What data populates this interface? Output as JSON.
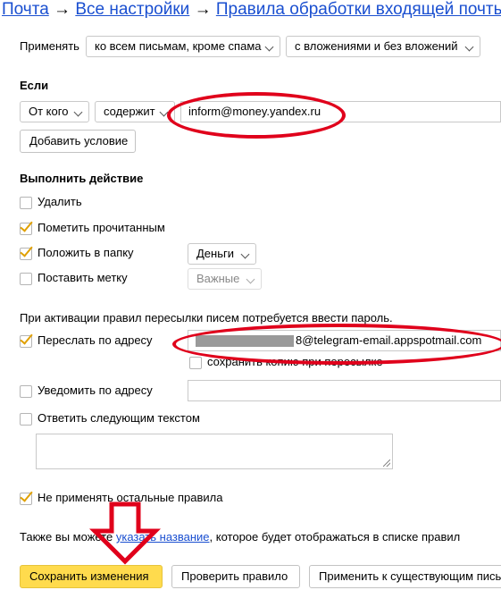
{
  "breadcrumb": {
    "mail": "Почта",
    "arrow": "→",
    "settings": "Все настройки",
    "rules": "Правила обработки входящей почты"
  },
  "apply": {
    "label": "Применять",
    "scope": "ко всем письмам, кроме спама",
    "attachments": "с вложениями и без вложений"
  },
  "condition": {
    "heading": "Если",
    "field": "От кого",
    "operator": "содержит",
    "value": "inform@money.yandex.ru",
    "add_button": "Добавить условие"
  },
  "actions": {
    "heading": "Выполнить действие",
    "delete": {
      "label": "Удалить",
      "checked": false
    },
    "mark_read": {
      "label": "Пометить прочитанным",
      "checked": true
    },
    "move_folder": {
      "label": "Положить в папку",
      "checked": true,
      "folder": "Деньги"
    },
    "set_label": {
      "label": "Поставить метку",
      "checked": false,
      "label_value": "Важные"
    }
  },
  "forwarding": {
    "notice": "При активации правил пересылки писем потребуется ввести пароль.",
    "forward": {
      "label": "Переслать по адресу",
      "checked": true,
      "address_suffix": "8@telegram-email.appspotmail.com"
    },
    "save_copy": {
      "label": "сохранить копию при пересылке",
      "checked": false
    },
    "notify": {
      "label": "Уведомить по адресу",
      "checked": false,
      "value": ""
    },
    "reply": {
      "label": "Ответить следующим текстом",
      "checked": false,
      "text": ""
    }
  },
  "stop_rules": {
    "label": "Не применять остальные правила",
    "checked": true
  },
  "name_hint": {
    "before": "Также вы можете ",
    "link": "указать название",
    "after": ", которое будет отображаться в списке правил"
  },
  "footer": {
    "save": "Сохранить изменения",
    "check": "Проверить правило",
    "apply_existing": "Применить к существующим письмам"
  },
  "colors": {
    "accent": "#ffdb4d",
    "link": "#1a4fd0",
    "annotation": "#e0001b",
    "checkmark": "#e0a000"
  }
}
